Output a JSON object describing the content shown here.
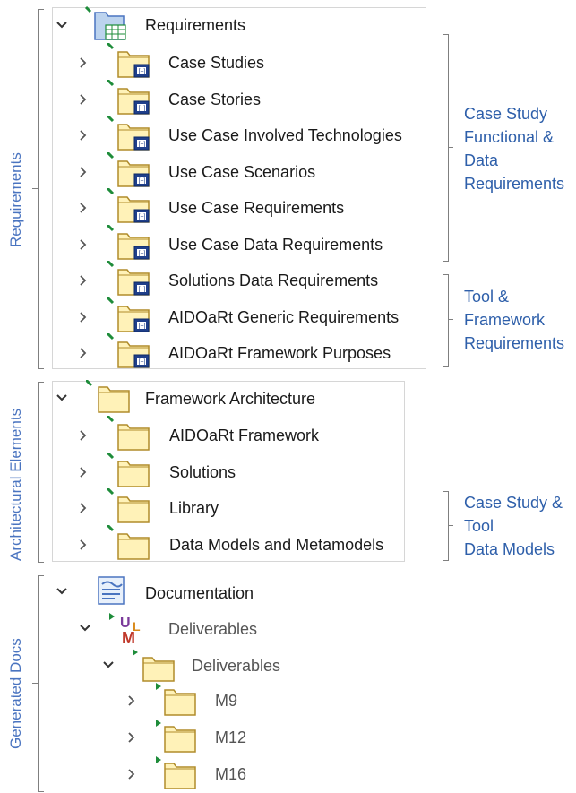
{
  "groups": {
    "requirements": "Requirements",
    "architectural": "Architectural Elements",
    "generated": "Generated Docs"
  },
  "notes": {
    "case_study": "Case Study\nFunctional &\nData\nRequirements",
    "tool": "Tool &\nFramework\nRequirements",
    "data_models": "Case Study &\nTool\nData Models"
  },
  "tree": {
    "requirements": {
      "label": "Requirements",
      "items": [
        "Case Studies",
        "Case Stories",
        "Use Case Involved Technologies",
        "Use Case Scenarios",
        "Use Case Requirements",
        "Use Case Data Requirements",
        "Solutions Data Requirements",
        "AIDOaRt Generic Requirements",
        "AIDOaRt Framework Purposes"
      ]
    },
    "architecture": {
      "label": "Framework Architecture",
      "items": [
        "AIDOaRt Framework",
        "Solutions",
        "Library",
        "Data Models and Metamodels"
      ]
    },
    "documentation": {
      "label": "Documentation",
      "deliverables_model": "Deliverables",
      "deliverables_folder": "Deliverables",
      "items": [
        "M9",
        "M12",
        "M16"
      ]
    }
  },
  "colors": {
    "folder_fill": "#fff2b8",
    "folder_stroke": "#b08c2a",
    "accent_blue": "#2e5faa",
    "tab_green": "#1e8c3a"
  }
}
